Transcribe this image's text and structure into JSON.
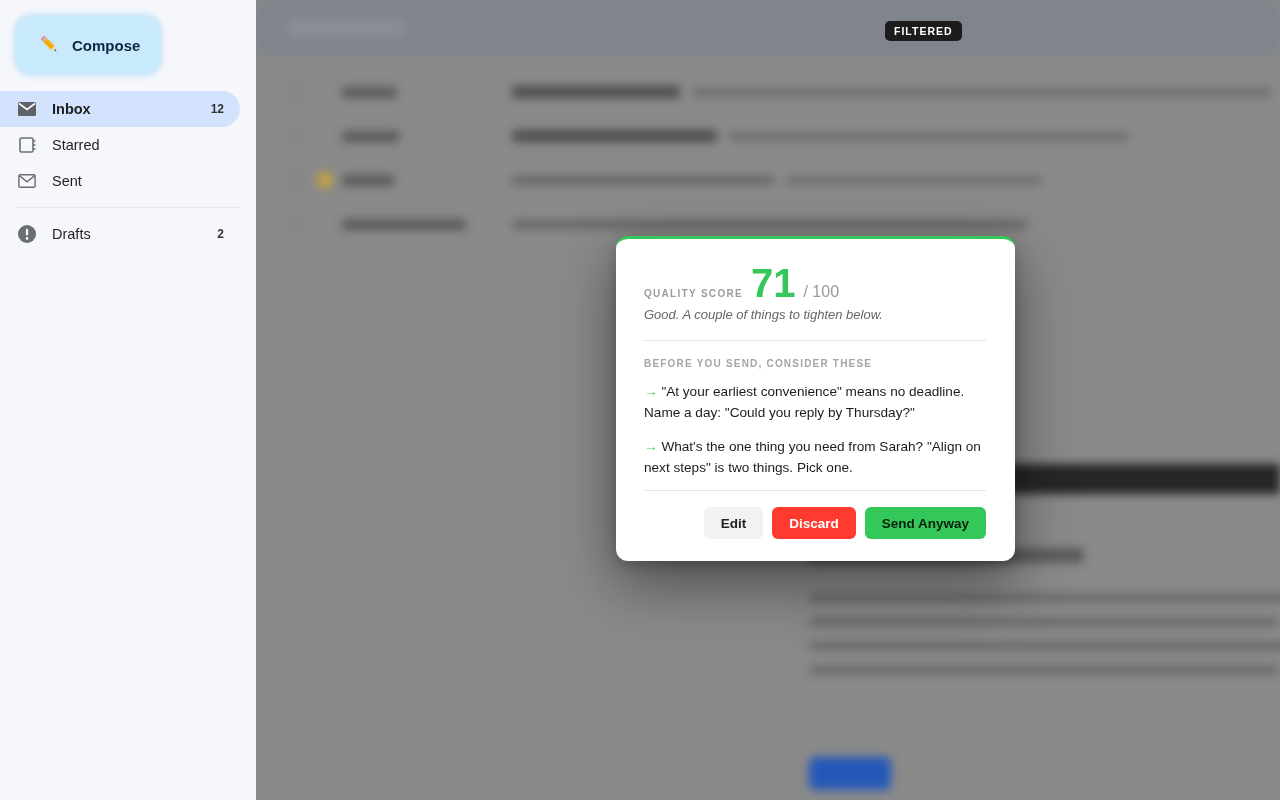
{
  "sidebar": {
    "compose": "Compose",
    "items": [
      {
        "label": "Inbox",
        "count": "12",
        "selected": true
      },
      {
        "label": "Starred",
        "selected": false
      },
      {
        "label": "Sent",
        "selected": false
      }
    ],
    "secondary_items": [
      {
        "label": "Drafts",
        "count": "2",
        "selected": false
      }
    ]
  },
  "filter_badge": "FILTERED",
  "dialog": {
    "score_label": "QUALITY SCORE",
    "score": "71",
    "score_max": "/ 100",
    "verdict": "Good. A couple of things to tighten below.",
    "section_title": "BEFORE YOU SEND, CONSIDER THESE",
    "suggestions": [
      {
        "marker": "→",
        "text": "\"At your earliest convenience\" means no deadline. Name a day: \"Could you reply by Thursday?\""
      },
      {
        "marker": "→",
        "text": "What's the one thing you need from Sarah? \"Align on next steps\" is two things. Pick one."
      }
    ],
    "buttons": [
      {
        "label": "Edit",
        "kind": "secondary"
      },
      {
        "label": "Discard",
        "kind": "danger"
      },
      {
        "label": "Send Anyway",
        "kind": "primary"
      }
    ]
  }
}
